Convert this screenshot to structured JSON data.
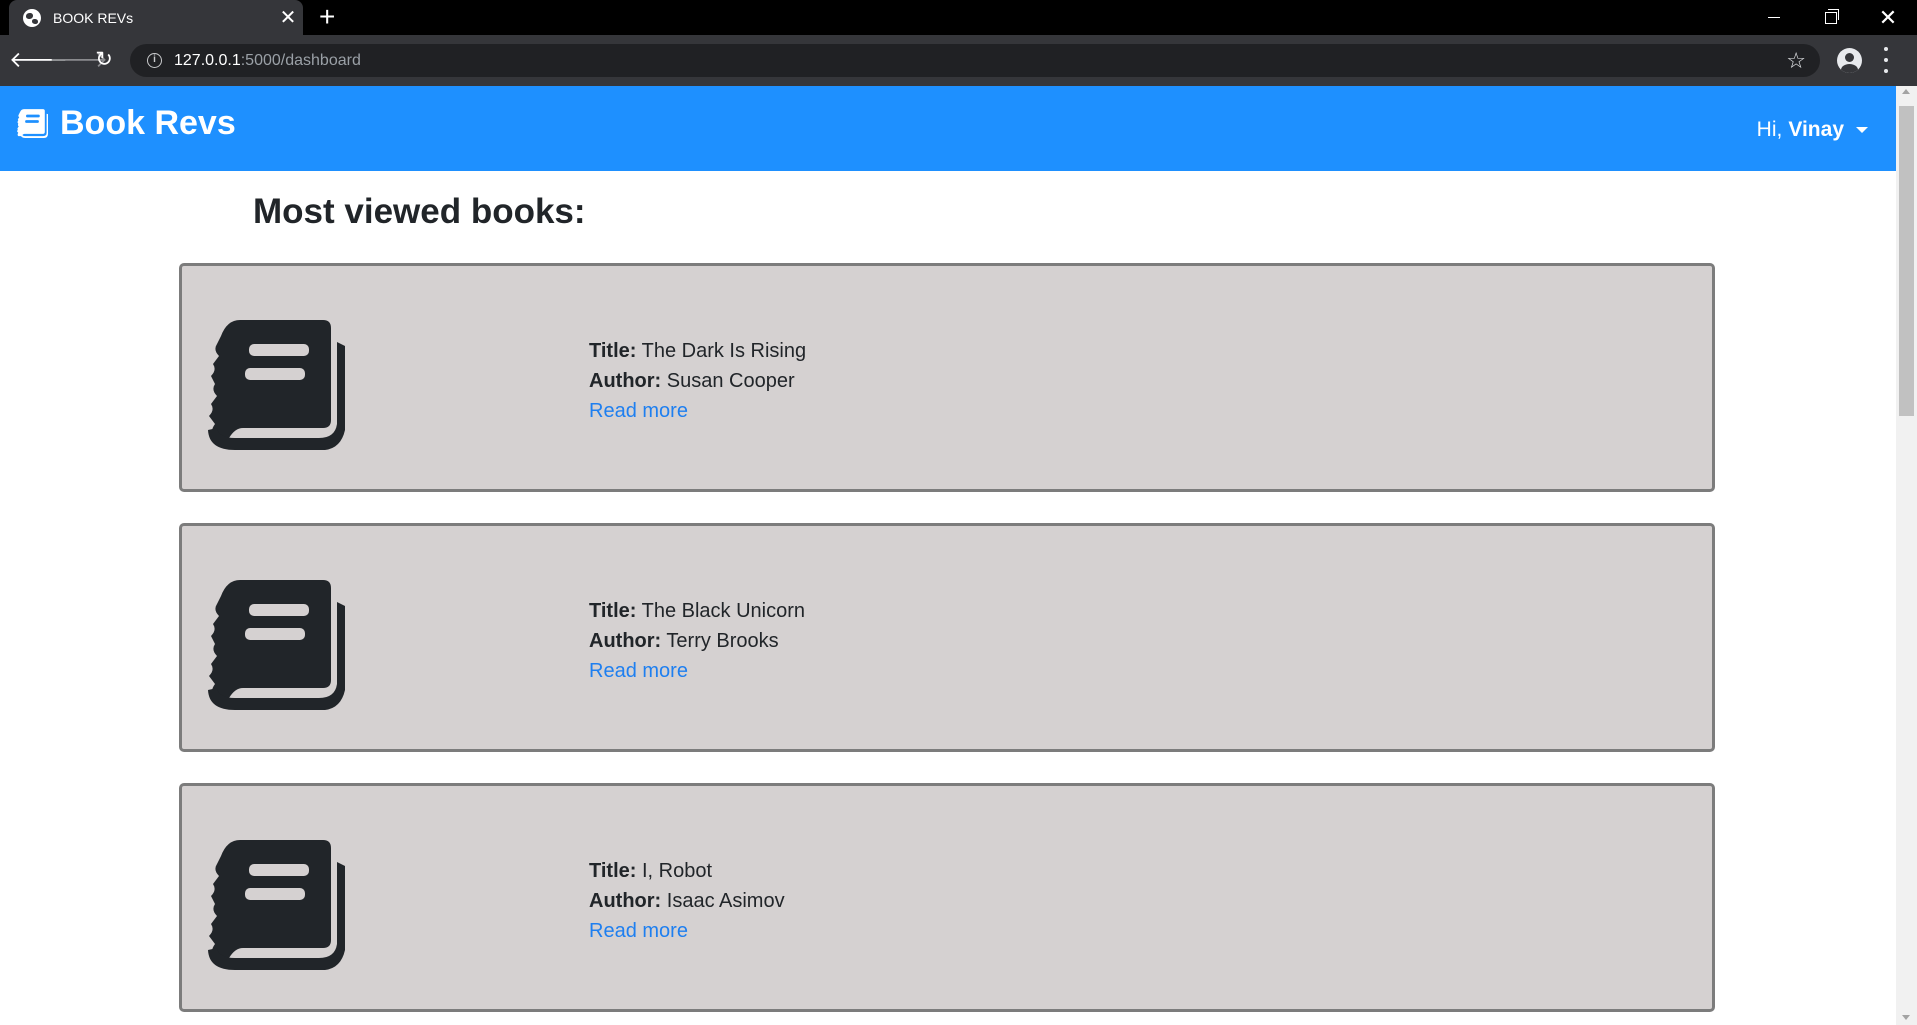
{
  "browser": {
    "tab_title": "BOOK REVs",
    "tab_close": "✕",
    "new_tab": "+",
    "url_host": "127.0.0.1",
    "url_path": ":5000/dashboard"
  },
  "navbar": {
    "brand": "Book Revs",
    "greeting": "Hi,",
    "user_name": "Vinay"
  },
  "main": {
    "heading": "Most viewed books:",
    "books": [
      {
        "title_label": "Title:",
        "title": "The Dark Is Rising",
        "author_label": "Author:",
        "author": "Susan Cooper",
        "link": "Read more"
      },
      {
        "title_label": "Title:",
        "title": "The Black Unicorn",
        "author_label": "Author:",
        "author": "Terry Brooks",
        "link": "Read more"
      },
      {
        "title_label": "Title:",
        "title": "I, Robot",
        "author_label": "Author:",
        "author": "Isaac Asimov",
        "link": "Read more"
      }
    ]
  },
  "colors": {
    "navbar": "#1e90ff",
    "card_bg": "#d5d1d1",
    "card_border": "#7c7c7c",
    "link": "#1e7ff0",
    "icon": "#212529"
  },
  "icons": {
    "brand": "book-icon",
    "card": "book-icon",
    "user_menu": "caret-down-icon"
  }
}
